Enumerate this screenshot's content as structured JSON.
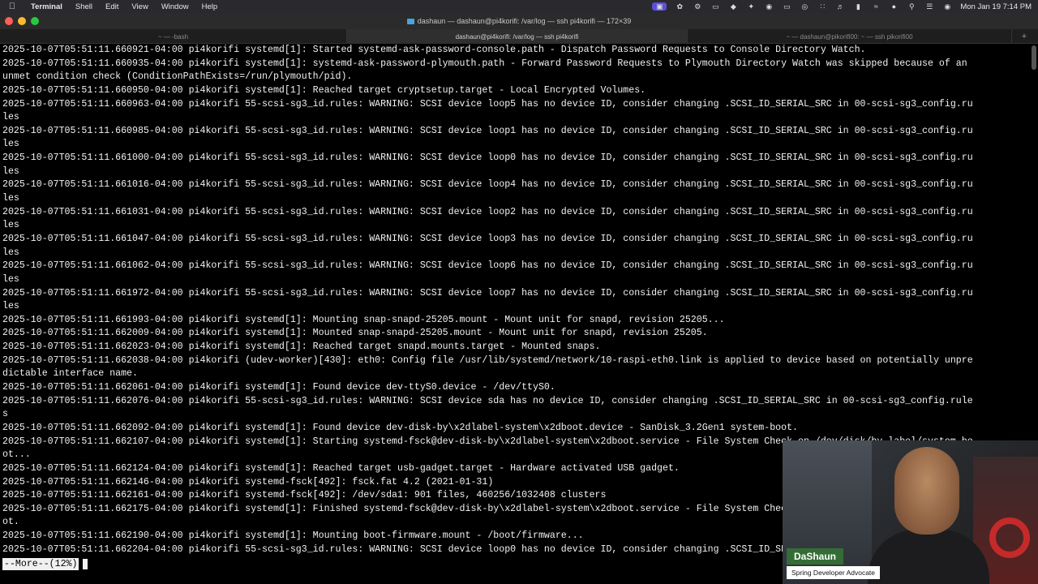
{
  "menubar": {
    "app_name": "Terminal",
    "items": [
      "Shell",
      "Edit",
      "View",
      "Window",
      "Help"
    ],
    "clock": "Mon Jan 19  7:14 PM"
  },
  "window": {
    "title": "dashaun — dashaun@pi4korifi: /var/log — ssh pi4korifi — 172×39"
  },
  "tabs": [
    {
      "label": "~ — -bash"
    },
    {
      "label": "dashaun@pi4korifi: /var/log — ssh pi4korifi"
    },
    {
      "label": "~ — dashaun@pikorifi00: ~ — ssh pikorifi00"
    }
  ],
  "terminal": {
    "lines": [
      "2025-10-07T05:51:11.660921-04:00 pi4korifi systemd[1]: Started systemd-ask-password-console.path - Dispatch Password Requests to Console Directory Watch.",
      "2025-10-07T05:51:11.660935-04:00 pi4korifi systemd[1]: systemd-ask-password-plymouth.path - Forward Password Requests to Plymouth Directory Watch was skipped because of an",
      "unmet condition check (ConditionPathExists=/run/plymouth/pid).",
      "2025-10-07T05:51:11.660950-04:00 pi4korifi systemd[1]: Reached target cryptsetup.target - Local Encrypted Volumes.",
      "2025-10-07T05:51:11.660963-04:00 pi4korifi 55-scsi-sg3_id.rules: WARNING: SCSI device loop5 has no device ID, consider changing .SCSI_ID_SERIAL_SRC in 00-scsi-sg3_config.ru",
      "les",
      "2025-10-07T05:51:11.660985-04:00 pi4korifi 55-scsi-sg3_id.rules: WARNING: SCSI device loop1 has no device ID, consider changing .SCSI_ID_SERIAL_SRC in 00-scsi-sg3_config.ru",
      "les",
      "2025-10-07T05:51:11.661000-04:00 pi4korifi 55-scsi-sg3_id.rules: WARNING: SCSI device loop0 has no device ID, consider changing .SCSI_ID_SERIAL_SRC in 00-scsi-sg3_config.ru",
      "les",
      "2025-10-07T05:51:11.661016-04:00 pi4korifi 55-scsi-sg3_id.rules: WARNING: SCSI device loop4 has no device ID, consider changing .SCSI_ID_SERIAL_SRC in 00-scsi-sg3_config.ru",
      "les",
      "2025-10-07T05:51:11.661031-04:00 pi4korifi 55-scsi-sg3_id.rules: WARNING: SCSI device loop2 has no device ID, consider changing .SCSI_ID_SERIAL_SRC in 00-scsi-sg3_config.ru",
      "les",
      "2025-10-07T05:51:11.661047-04:00 pi4korifi 55-scsi-sg3_id.rules: WARNING: SCSI device loop3 has no device ID, consider changing .SCSI_ID_SERIAL_SRC in 00-scsi-sg3_config.ru",
      "les",
      "2025-10-07T05:51:11.661062-04:00 pi4korifi 55-scsi-sg3_id.rules: WARNING: SCSI device loop6 has no device ID, consider changing .SCSI_ID_SERIAL_SRC in 00-scsi-sg3_config.ru",
      "les",
      "2025-10-07T05:51:11.661972-04:00 pi4korifi 55-scsi-sg3_id.rules: WARNING: SCSI device loop7 has no device ID, consider changing .SCSI_ID_SERIAL_SRC in 00-scsi-sg3_config.ru",
      "les",
      "2025-10-07T05:51:11.661993-04:00 pi4korifi systemd[1]: Mounting snap-snapd-25205.mount - Mount unit for snapd, revision 25205...",
      "2025-10-07T05:51:11.662009-04:00 pi4korifi systemd[1]: Mounted snap-snapd-25205.mount - Mount unit for snapd, revision 25205.",
      "2025-10-07T05:51:11.662023-04:00 pi4korifi systemd[1]: Reached target snapd.mounts.target - Mounted snaps.",
      "2025-10-07T05:51:11.662038-04:00 pi4korifi (udev-worker)[430]: eth0: Config file /usr/lib/systemd/network/10-raspi-eth0.link is applied to device based on potentially unpre",
      "dictable interface name.",
      "2025-10-07T05:51:11.662061-04:00 pi4korifi systemd[1]: Found device dev-ttyS0.device - /dev/ttyS0.",
      "2025-10-07T05:51:11.662076-04:00 pi4korifi 55-scsi-sg3_id.rules: WARNING: SCSI device sda has no device ID, consider changing .SCSI_ID_SERIAL_SRC in 00-scsi-sg3_config.rule",
      "s",
      "2025-10-07T05:51:11.662092-04:00 pi4korifi systemd[1]: Found device dev-disk-by\\x2dlabel-system\\x2dboot.device - SanDisk_3.2Gen1 system-boot.",
      "2025-10-07T05:51:11.662107-04:00 pi4korifi systemd[1]: Starting systemd-fsck@dev-disk-by\\x2dlabel-system\\x2dboot.service - File System Check on /dev/disk/by-label/system-bo",
      "ot...",
      "2025-10-07T05:51:11.662124-04:00 pi4korifi systemd[1]: Reached target usb-gadget.target - Hardware activated USB gadget.",
      "2025-10-07T05:51:11.662146-04:00 pi4korifi systemd-fsck[492]: fsck.fat 4.2 (2021-01-31)",
      "2025-10-07T05:51:11.662161-04:00 pi4korifi systemd-fsck[492]: /dev/sda1: 901 files, 460256/1032408 clusters",
      "2025-10-07T05:51:11.662175-04:00 pi4korifi systemd[1]: Finished systemd-fsck@dev-disk-by\\x2dlabel-system\\x2dboot.service - File System Check on /dev/disk/by-label/system-bo",
      "ot.",
      "2025-10-07T05:51:11.662190-04:00 pi4korifi systemd[1]: Mounting boot-firmware.mount - /boot/firmware...",
      "2025-10-07T05:51:11.662204-04:00 pi4korifi 55-scsi-sg3_id.rules: WARNING: SCSI device loop0 has no device ID, consider changing .SCSI_ID_SERIAL_SRC in 00-scsi-sg3_config.ru"
    ],
    "pager_prompt": "--More--(12%)"
  },
  "webcam": {
    "name": "DaShaun",
    "role": "Spring Developer Advocate"
  }
}
